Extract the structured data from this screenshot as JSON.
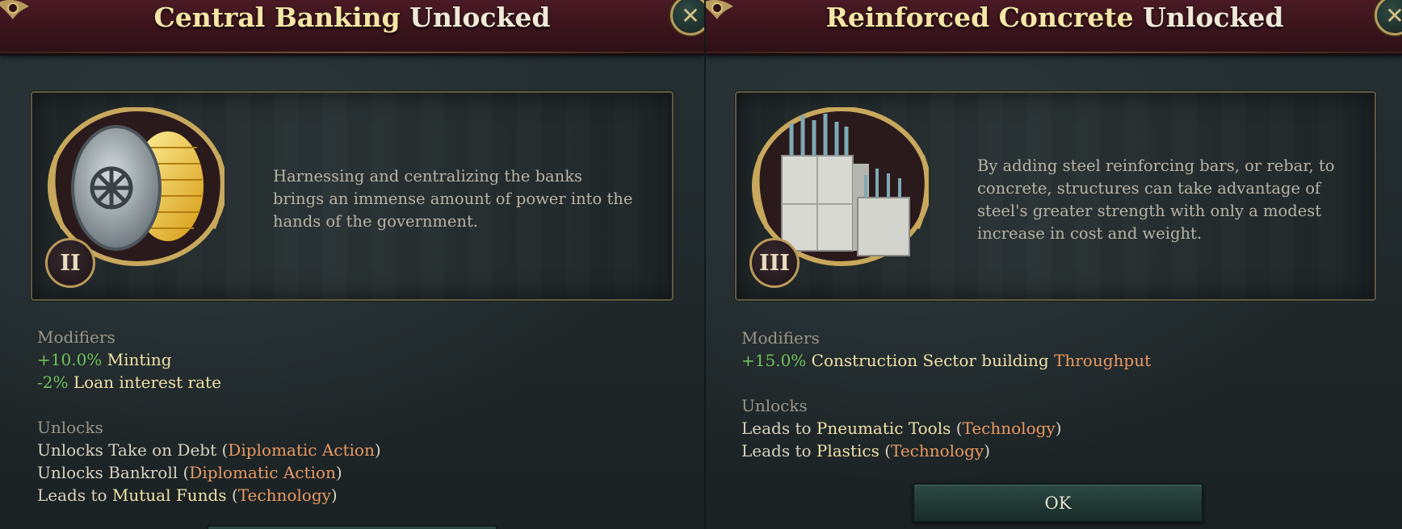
{
  "left_panel": {
    "title_name": "Central Banking",
    "title_suffix": "Unlocked",
    "rank": "II",
    "description": "Harnessing and centralizing the banks brings an immense amount of power into the hands of the government.",
    "modifiers_title": "Modifiers",
    "modifiers": [
      {
        "value": "+10.0%",
        "label": "Minting"
      },
      {
        "value": "-2%",
        "label": "Loan interest rate"
      }
    ],
    "unlocks_title": "Unlocks",
    "unlocks": [
      {
        "prefix": "Unlocks Take on Debt (",
        "link": "Diplomatic Action",
        "suffix": ")"
      },
      {
        "prefix": "Unlocks Bankroll (",
        "link": "Diplomatic Action",
        "suffix": ")"
      },
      {
        "prefix": "Leads to ",
        "target": "Mutual Funds",
        "mid": " (",
        "link": "Technology",
        "suffix": ")"
      }
    ],
    "icon": "vault-icon"
  },
  "right_panel": {
    "title_name": "Reinforced Concrete",
    "title_suffix": "Unlocked",
    "rank": "III",
    "description": "By adding steel reinforcing bars, or rebar, to concrete, structures can take advantage of steel's greater strength with only a modest increase in cost and weight.",
    "modifiers_title": "Modifiers",
    "modifier": {
      "value": "+15.0%",
      "label": "Construction Sector building ",
      "link": "Throughput"
    },
    "unlocks_title": "Unlocks",
    "unlocks": [
      {
        "prefix": "Leads to ",
        "target": "Pneumatic Tools",
        "mid": " (",
        "link": "Technology",
        "suffix": ")"
      },
      {
        "prefix": "Leads to ",
        "target": "Plastics",
        "mid": " (",
        "link": "Technology",
        "suffix": ")"
      }
    ],
    "ok_label": "OK",
    "icon": "rebar-concrete-icon"
  },
  "colors": {
    "header": "#3a141c",
    "title_gold": "#f3e6a6",
    "positive": "#6fc35a",
    "link": "#e99a62",
    "background": "#1e2628"
  }
}
